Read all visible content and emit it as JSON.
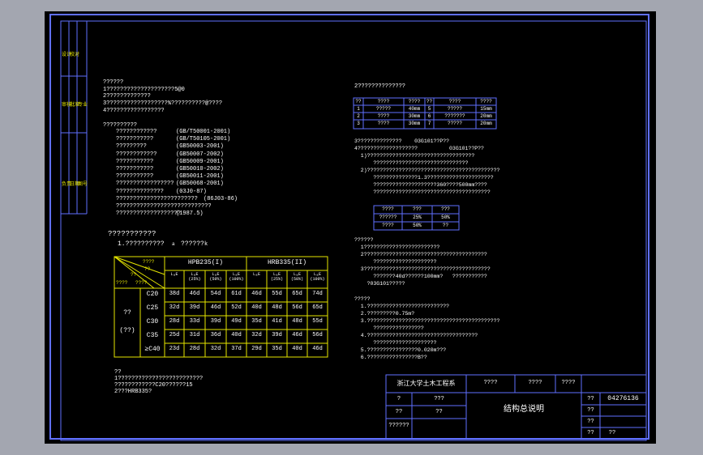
{
  "colors": {
    "frame": "#6070ff",
    "yellow": "#e6e600",
    "text": "#ffffff",
    "bg": "#000000",
    "outer": "#a3a6b0"
  },
  "left_sidebar": {
    "labels": [
      "设计",
      "校对",
      "审核",
      "批准",
      "专业",
      "负责",
      "日期",
      "图号",
      "工程"
    ]
  },
  "general": {
    "lines": [
      "??????",
      "1????????????????????5@0",
      "2?????????????",
      "3??????????????????%??????????@????",
      "4?????????????????"
    ],
    "heading2": "??????????",
    "standards": [
      {
        "name": "????????????",
        "code": "(GB/T50001-2001)"
      },
      {
        "name": "???????????",
        "code": "(GB/T50105-2001)"
      },
      {
        "name": "?????????",
        "code": "(GB50003-2001)"
      },
      {
        "name": "????????????",
        "code": "(GB50007-2002)"
      },
      {
        "name": "???????????",
        "code": "(GB50009-2001)"
      },
      {
        "name": "???????????",
        "code": "(GB50010-2002)"
      },
      {
        "name": "???????????",
        "code": "(GB50011-2001)"
      },
      {
        "name": "?????????????????",
        "code": "(GB50068-2001)"
      },
      {
        "name": "??????????????",
        "code": "(03J0-87)"
      },
      {
        "name": "????????????????????????",
        "code": "(86J03-86)"
      },
      {
        "name": "????????????????????????????",
        "code": ""
      },
      {
        "name": "???????????????????",
        "code": "(1987.5)"
      }
    ]
  },
  "anchor_table": {
    "title": "???????????",
    "subtitle": "1.??????????   ",
    "subtitle_b": "??????",
    "note_l": "a",
    "note_r": "k",
    "corner": [
      "????",
      "??",
      "??",
      "????",
      "????"
    ],
    "headers": {
      "hpb": "HPB235(Ι)",
      "hrb": "HRB335(ΙΙ)"
    },
    "subheaders": [
      "LₐE",
      "LₐE\n(25%)",
      "LₐE\n(50%)",
      "LₐE\n(100%)",
      "LₐE",
      "LₐE\n(25%)",
      "LₐE\n(50%)",
      "LₐE\n(100%)"
    ],
    "side": [
      "??",
      "(??)"
    ],
    "rows": [
      {
        "grade": "C20",
        "vals": [
          "38d",
          "46d",
          "54d",
          "61d",
          "46d",
          "55d",
          "65d",
          "74d"
        ]
      },
      {
        "grade": "C25",
        "vals": [
          "32d",
          "39d",
          "46d",
          "52d",
          "40d",
          "48d",
          "56d",
          "65d"
        ]
      },
      {
        "grade": "C30",
        "vals": [
          "28d",
          "33d",
          "39d",
          "49d",
          "35d",
          "41d",
          "48d",
          "55d"
        ]
      },
      {
        "grade": "C35",
        "vals": [
          "25d",
          "31d",
          "36d",
          "40d",
          "32d",
          "39d",
          "46d",
          "56d"
        ]
      },
      {
        "grade": "≥C40",
        "vals": [
          "23d",
          "28d",
          "32d",
          "37d",
          "29d",
          "35d",
          "40d",
          "46d"
        ]
      }
    ]
  },
  "notes": {
    "lines": [
      "??",
      "1?????????????????????????",
      "????????????C20??????15",
      "2???HRB335?"
    ]
  },
  "cover_section": {
    "title": "2??????????????",
    "headers": [
      "??",
      "????",
      "????",
      "??",
      "????",
      "????"
    ],
    "rows": [
      [
        "1",
        "?????",
        "40mm",
        "5",
        "?????",
        "15mm"
      ],
      [
        "2",
        "????",
        "30mm",
        "6",
        "???????",
        "20mm"
      ],
      [
        "3",
        "????",
        "30mm",
        "7",
        "?????",
        "20mm"
      ]
    ]
  },
  "section3": {
    "lines": [
      "3??????????????    03G101??P??",
      "4???????????????????          03G101??P??",
      "  1)??????????????????????????????????",
      "      ??????????????????????????????",
      "  2)??????????????????????????????????????????",
      "      ??????????????1.3?????????????????????",
      "      ????????????????????360????500mm????",
      "      ?????????????????????????????????????"
    ]
  },
  "ratio_table": {
    "rows": [
      [
        "????",
        "???",
        "???"
      ],
      [
        "??????",
        "25%",
        "50%"
      ],
      [
        "????",
        "50%",
        "??"
      ]
    ]
  },
  "section4": {
    "lines": [
      "??????",
      "  1????????????????????????",
      "  2???????????????????????????????????????",
      "      ????????????????????",
      "  3????????????????????????????????????????",
      "      ???????40d??????100mm?   ???????????",
      "    ?03G101?????"
    ]
  },
  "section5": {
    "lines": [
      "?????",
      "  1.??????????????????????????",
      "  2.?????????0.75m?",
      "  3.??????????????????????????????????????????",
      "      ????????????????",
      "  4.???????????????????????????????????",
      "      ????????????????????",
      "  5.????????????????0.020m???",
      "  6.????????????????B??"
    ]
  },
  "title_block": {
    "school": "浙江大学土木工程系",
    "drawing_title": "结构总说明",
    "drawing_no": "04276136",
    "top_cells": [
      "????",
      "????",
      "????"
    ],
    "left_cells": [
      "?",
      "???",
      "??",
      "??",
      "??????"
    ],
    "right_cells": [
      "??",
      "??",
      "??",
      "??",
      "??"
    ]
  }
}
